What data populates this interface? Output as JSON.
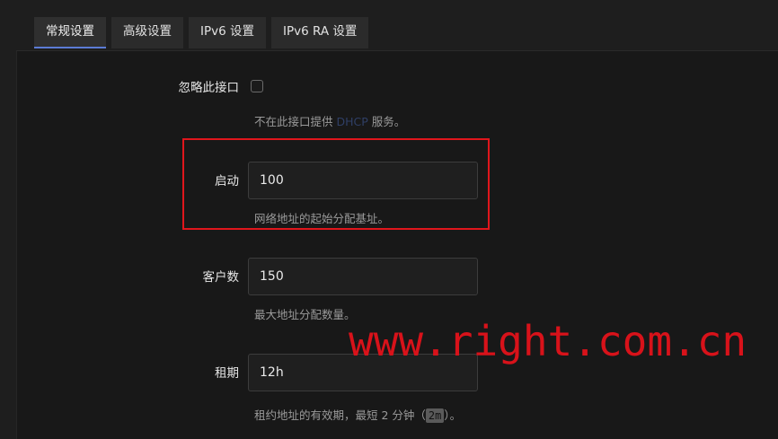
{
  "tabs": [
    {
      "label": "常规设置",
      "active": true
    },
    {
      "label": "高级设置"
    },
    {
      "label": "IPv6 设置"
    },
    {
      "label": "IPv6 RA 设置"
    }
  ],
  "ignore_interface": {
    "label": "忽略此接口",
    "checked": false,
    "desc_before": "不在此接口提供 ",
    "desc_link": "DHCP",
    "desc_after": " 服务。"
  },
  "start": {
    "label": "启动",
    "value": "100",
    "desc": "网络地址的起始分配基址。"
  },
  "limit": {
    "label": "客户数",
    "value": "150",
    "desc": "最大地址分配数量。"
  },
  "leasetime": {
    "label": "租期",
    "value": "12h",
    "desc_before": "租约地址的有效期，最短 2 分钟（",
    "desc_code": "2m",
    "desc_after": "）。"
  },
  "annotation": {
    "highlight_color": "#e0161c"
  },
  "watermark": {
    "text": "www.right.com.cn"
  }
}
